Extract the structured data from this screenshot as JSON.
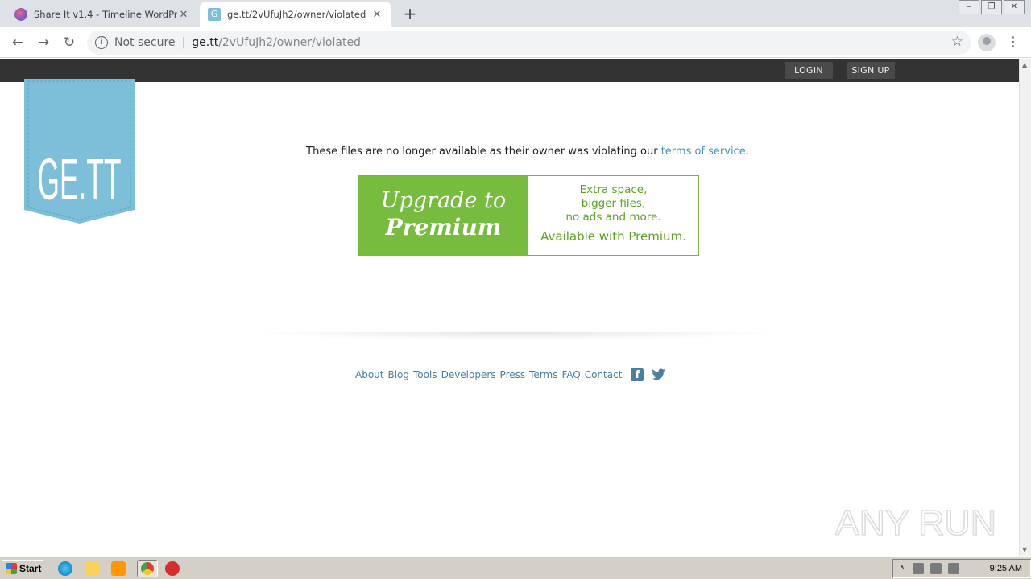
{
  "browser": {
    "tabs": [
      {
        "title": "Share It v1.4 - Timeline WordPress T",
        "active": false
      },
      {
        "title": "ge.tt/2vUfuJh2/owner/violated",
        "active": true
      }
    ],
    "new_tab": "+",
    "security_label": "Not secure",
    "url_host": "ge.tt",
    "url_path": "/2vUfuJh2/owner/violated"
  },
  "site": {
    "nav": {
      "login": "LOGIN",
      "signup": "SIGN UP"
    },
    "logo_text": "GE.TT",
    "message_before": "These files are no longer available as their owner was violating our ",
    "message_link": "terms of service",
    "message_after": ".",
    "upgrade": {
      "line1": "Upgrade to",
      "line2": "Premium",
      "benefits": [
        "Extra space,",
        "bigger files,",
        "no ads and more."
      ],
      "tagline": "Available with Premium."
    },
    "footer_links": [
      "About",
      "Blog",
      "Tools",
      "Developers",
      "Press",
      "Terms",
      "FAQ",
      "Contact"
    ]
  },
  "watermark": "ANY RUN",
  "taskbar": {
    "start": "Start",
    "time": "9:25 AM"
  },
  "colors": {
    "accent_blue": "#7dbfd9",
    "premium_green": "#77bb3f",
    "link": "#4a7fa0",
    "topbar": "#333333"
  }
}
